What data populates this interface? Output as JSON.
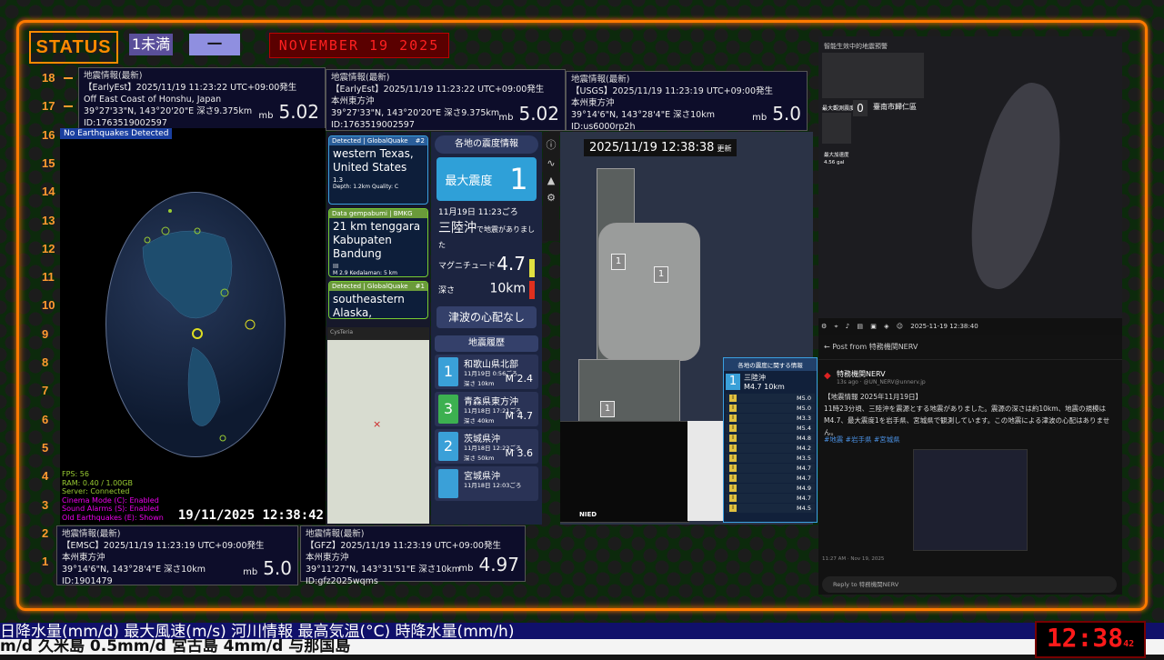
{
  "status": {
    "label": "STATUS",
    "chip_a": "1未満",
    "chip_b": "一",
    "date": "NOVEMBER 19 2025"
  },
  "ruler": [
    "18",
    "17",
    "16",
    "15",
    "14",
    "13",
    "12",
    "11",
    "10",
    "9",
    "8",
    "7",
    "6",
    "5",
    "4",
    "3",
    "2",
    "1"
  ],
  "quakes": {
    "earlyest_en": {
      "header": "地震情報(最新)",
      "line1": "【EarlyEst】2025/11/19 11:23:22 UTC+09:00発生",
      "place": "Off East Coast of Honshu, Japan",
      "coords": "39°27'33\"N, 143°20'20\"E 深さ9.375km",
      "id": "ID:1763519002597",
      "mag_unit": "mb",
      "mag": "5.02"
    },
    "earlyest_jp": {
      "header": "地震情報(最新)",
      "line1": "【EarlyEst】2025/11/19 11:23:22 UTC+09:00発生",
      "place": "本州東方沖",
      "coords": "39°27'33\"N, 143°20'20\"E 深さ9.375km",
      "id": "ID:1763519002597",
      "mag_unit": "mb",
      "mag": "5.02"
    },
    "usgs": {
      "header": "地震情報(最新)",
      "line1": "【USGS】2025/11/19 11:23:19 UTC+09:00発生",
      "place": "本州東方沖",
      "coords": "39°14'6\"N, 143°28'4\"E 深さ10km",
      "id": "ID:us6000rp2h",
      "mag_unit": "mb",
      "mag": "5.0"
    },
    "emsc": {
      "header": "地震情報(最新)",
      "line1": "【EMSC】2025/11/19 11:23:19 UTC+09:00発生",
      "place": "本州東方沖",
      "coords": "39°14'6\"N, 143°28'4\"E 深さ10km",
      "id": "ID:1901479",
      "mag_unit": "mb",
      "mag": "5.0"
    },
    "gfz": {
      "header": "地震情報(最新)",
      "line1": "【GFZ】2025/11/19 11:23:19 UTC+09:00発生",
      "place": "本州東方沖",
      "coords": "39°11'27\"N, 143°31'51\"E 深さ10km",
      "id": "ID:gfz2025wqms",
      "mag_unit": "mb",
      "mag": "4.97"
    }
  },
  "globe": {
    "tag": "No Earthquakes Detected",
    "stats": [
      "FPS: 56",
      "RAM: 0.40 / 1.00GB",
      "Server: Connected",
      "Cinema Mode (C): Enabled",
      "Sound Alarms (S): Enabled",
      "Old Earthquakes (E): Shown"
    ],
    "time": "19/11/2025 12:38:42"
  },
  "detections": [
    {
      "top": "Detected | GlobalQuake",
      "num": "#2",
      "mag": "1.3",
      "place": "western Texas, United States",
      "sub": "Depth: 1.2km  Quality: C",
      "style": "blue"
    },
    {
      "top": "Data gempabumi | BMKG",
      "num": "",
      "mag": "III",
      "place": "21 km tenggara Kabupaten Bandung",
      "sub": "M 2.9  Kedalaman: 5 km",
      "style": "green"
    },
    {
      "top": "Detected | GlobalQuake",
      "num": "#1",
      "mag": "",
      "place": "southeastern Alaska,",
      "sub": "",
      "style": "green"
    }
  ],
  "mini_map": {
    "bar": "CysTeria"
  },
  "jp_app": {
    "title": "各地の震度情報",
    "max_label": "最大震度",
    "max_val": "1",
    "time": "11月19日 11:23ごろ",
    "place": "三陸沖",
    "place_suffix": "で地震がありました",
    "mag_label": "マグニチュード",
    "mag_val": "4.7",
    "depth_label": "深さ",
    "depth_val": "10km",
    "tsunami": "津波の心配なし",
    "hist_title": "地震履歴",
    "history": [
      {
        "shindo": "1",
        "place": "和歌山県北部",
        "time": "11月19日 0:56ごろ",
        "depth": "深さ 10km",
        "mag": "M 2.4",
        "cls": "s1"
      },
      {
        "shindo": "3",
        "place": "青森県東方沖",
        "time": "11月18日 17:21ごろ",
        "depth": "深さ 40km",
        "mag": "M 4.7",
        "cls": "s3"
      },
      {
        "shindo": "2",
        "place": "茨城県沖",
        "time": "11月18日 12:23ごろ",
        "depth": "深さ 50km",
        "mag": "M 3.6",
        "cls": "s2"
      },
      {
        "shindo": "",
        "place": "宮城県沖",
        "time": "11月18日 12:03ごろ",
        "depth": "",
        "mag": "",
        "cls": "s1"
      }
    ]
  },
  "map": {
    "time": "2025/11/19 12:38:38",
    "suffix": "更新",
    "badges": [
      "1",
      "1",
      "1"
    ],
    "nied": "NIED"
  },
  "intensity_list": {
    "head": "各地の震度に関する情報",
    "main_n": "1",
    "main_place": "三陸沖",
    "main_mag": "M4.7",
    "main_depth": "10km",
    "rows": [
      "M5.0",
      "M5.0",
      "M3.3",
      "M5.4",
      "M4.8",
      "M4.2",
      "M3.5",
      "M4.7",
      "M4.7",
      "M4.9",
      "M4.7",
      "M4.5"
    ]
  },
  "taiwan": {
    "title": "智能生效中的地震預警",
    "max_label": "最大觀測震度",
    "max_val": "0",
    "station": "臺南市歸仁區",
    "accel_label": "最大加速度",
    "accel": "4.56 gal",
    "timestamp": "2025-11-19 12:38:40"
  },
  "post": {
    "header": "Post from 特務機関NERV",
    "author": "特務機関NERV",
    "handle": "13s ago · @UN_NERV@unnerv.jp",
    "body_1": "【地震情報 2025年11月19日】",
    "body_2": "11時23分頃、三陸沖を震源とする地震がありました。震源の深さは約10km、地震の規模はM4.7、最大震度1を岩手県、宮城県で観測しています。この地震による津波の心配はありません。",
    "tags": "#地震 #岩手県 #宮城県",
    "time": "11:27 AM · Nov 19, 2025",
    "reply": "Reply to 特務機関NERV"
  },
  "ticker": {
    "top": "日降水量(mm/d)  最大風速(m/s)   河川情報    最高気温(°C)   時降水量(mm/h)",
    "bottom": "m/d   久米島 0.5mm/d      宮古島 4mm/d     与那国島"
  },
  "clock": {
    "time": "12:38",
    "sec": "42"
  },
  "colors": {
    "frame": "#ff7a00",
    "ticker_bg": "#10106a",
    "clock": "#ff1a1a"
  }
}
